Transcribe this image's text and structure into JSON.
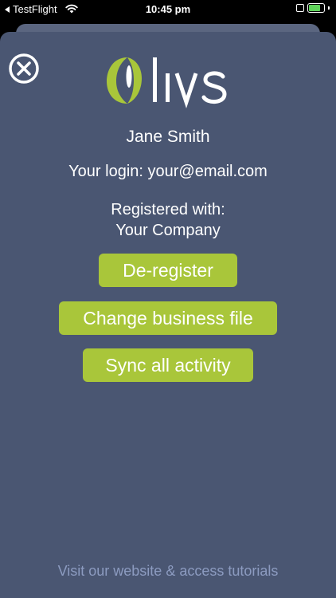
{
  "status_bar": {
    "back_app": "TestFlight",
    "time": "10:45 pm",
    "battery_level": 0.9,
    "battery_color": "#5fd35a"
  },
  "icons": {
    "close": "close-circle-icon",
    "wifi": "wifi-icon",
    "battery": "battery-charging-icon"
  },
  "logo": {
    "text": "Olivs",
    "accent_color": "#a9c63a"
  },
  "account": {
    "name": "Jane Smith",
    "login": "Your login: your@email.com",
    "registered_label": "Registered with:",
    "company": "Your Company"
  },
  "actions": {
    "deregister": "De-register",
    "change_file": "Change business file",
    "sync": "Sync all activity"
  },
  "footer": {
    "link": "Visit our website & access tutorials"
  },
  "colors": {
    "sheet": "#4a5672",
    "button": "#a9c63a",
    "footer_link": "#8c9bc0"
  }
}
